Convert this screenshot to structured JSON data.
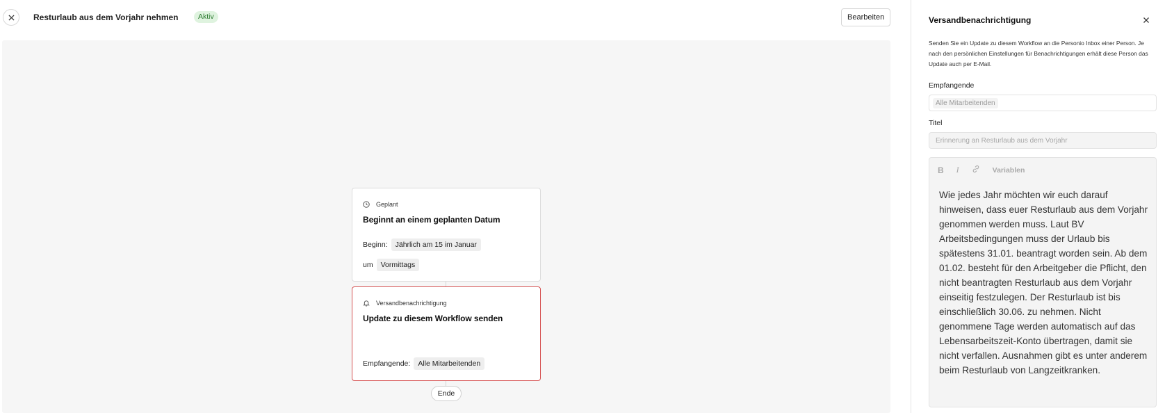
{
  "header": {
    "title": "Resturlaub aus dem Vorjahr nehmen",
    "status": "Aktiv",
    "edit_label": "Bearbeiten"
  },
  "workflow": {
    "trigger": {
      "type_label": "Geplant",
      "title": "Beginnt an einem geplanten Datum",
      "start_label": "Beginn:",
      "start_value": "Jährlich am 15 im Januar",
      "time_label": "um",
      "time_value": "Vormittags"
    },
    "action": {
      "type_label": "Versandbenachrichtigung",
      "title": "Update zu diesem Workflow senden",
      "recipients_label": "Empfangende:",
      "recipients_value": "Alle Mitarbeitenden"
    },
    "end_label": "Ende"
  },
  "panel": {
    "title": "Versandbenachrichtigung",
    "description": "Senden Sie ein Update zu diesem Workflow an die Personio Inbox einer Person. Je nach den persönlichen Einstellungen für Benachrichtigungen erhält diese Person das Update auch per E-Mail.",
    "recipients_label": "Empfangende",
    "recipients_value": "Alle Mitarbeitenden",
    "title_label": "Titel",
    "title_value": "Erinnerung an Resturlaub aus dem Vorjahr",
    "toolbar": {
      "bold": "B",
      "italic": "I",
      "variables": "Variablen"
    },
    "body": "Wie jedes Jahr möchten wir euch darauf hinweisen, dass euer Resturlaub aus dem Vorjahr genommen werden muss. Laut BV Arbeitsbedingungen muss der Urlaub bis spätestens 31.01. beantragt worden sein. Ab dem 01.02. besteht für den Arbeitgeber die Pflicht, den nicht beantragten Resturlaub aus dem Vorjahr einseitig festzulegen. Der Resturlaub ist bis einschließlich 30.06. zu nehmen. Nicht genommene Tage werden automatisch auf das Lebensarbeitszeit-Konto übertragen, damit sie nicht verfallen. Ausnahmen gibt es unter anderem beim Resturlaub von Langzeitkranken."
  },
  "colors": {
    "status_bg": "#dff3df",
    "status_text": "#2a7a2e",
    "selected_border": "#d65050",
    "canvas_bg": "#f6f6f6"
  },
  "icons": {
    "close": "close-icon",
    "clock": "clock-icon",
    "bell": "bell-icon",
    "link": "link-icon"
  }
}
